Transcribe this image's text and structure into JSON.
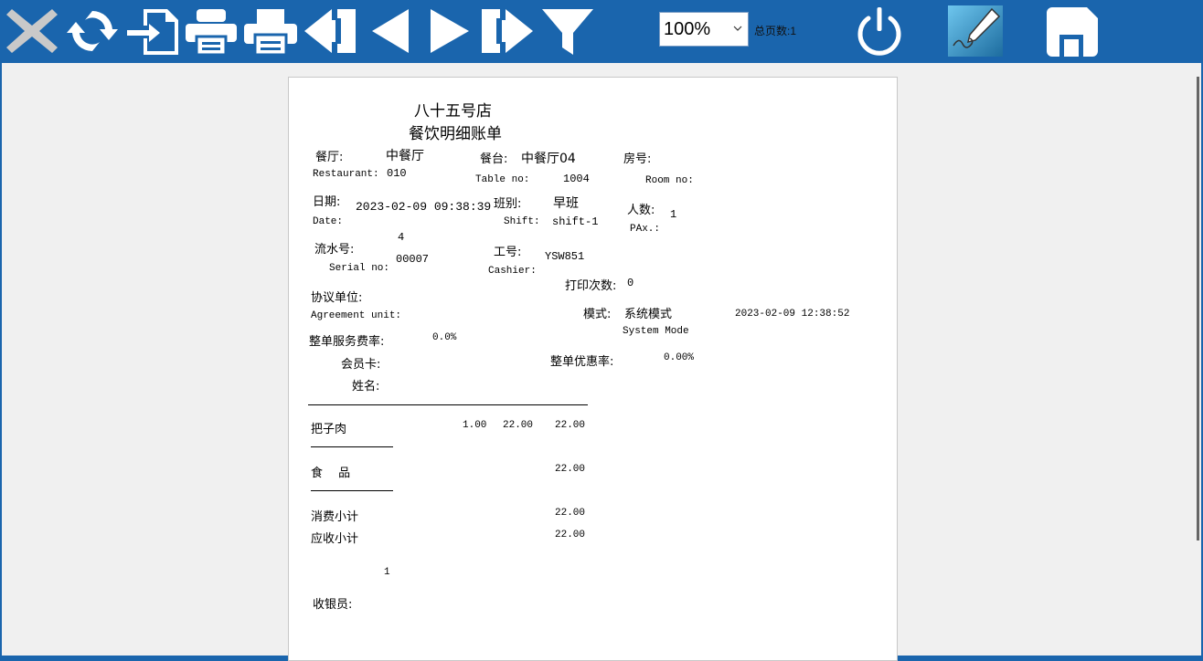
{
  "toolbar": {
    "buttons": [
      {
        "name": "close-icon",
        "label": "close"
      },
      {
        "name": "refresh-icon",
        "label": "refresh"
      },
      {
        "name": "export-icon",
        "label": "export"
      },
      {
        "name": "print-setup-icon",
        "label": "print setup"
      },
      {
        "name": "printer-icon",
        "label": "print"
      },
      {
        "name": "first-page-icon",
        "label": "first page"
      },
      {
        "name": "prev-page-icon",
        "label": "previous page"
      },
      {
        "name": "next-page-icon",
        "label": "next page"
      },
      {
        "name": "last-page-icon",
        "label": "last page"
      },
      {
        "name": "filter-icon",
        "label": "filter"
      },
      {
        "name": "power-icon",
        "label": "exit"
      },
      {
        "name": "signature-pen-icon",
        "label": "sign"
      },
      {
        "name": "save-icon",
        "label": "save"
      }
    ],
    "zoom": "100%",
    "page_count_label": "总页数:1",
    "colors": {
      "bar": "#1a65ad",
      "icon": "#ffffff",
      "close_icon": "#c9c9c9"
    }
  },
  "receipt": {
    "store_name": "八十五号店",
    "title": "餐饮明细账单",
    "restaurant_cn": "餐厅:",
    "restaurant_value": "中餐厅",
    "restaurant_en": "Restaurant:",
    "restaurant_code": "010",
    "table_cn": "餐台:",
    "table_value": "中餐厅04",
    "table_en": "Table no:",
    "table_no": "1004",
    "room_cn": "房号:",
    "room_en": "Room no:",
    "date_cn": "日期:",
    "date_value": "2023-02-09 09:38:39",
    "date_en": "Date:",
    "shift_cn": "班别:",
    "shift_value": "早班",
    "shift_en": "Shift:",
    "shift_code": "shift-1",
    "pax_cn": "人数:",
    "pax_en": "PAx.:",
    "pax_value": "1",
    "serial_cn": "流水号:",
    "serial_top": "4",
    "serial_en": "Serial no:",
    "serial_value": "00007",
    "cashier_cn": "工号:",
    "cashier_value": "YSW851",
    "cashier_en": "Cashier:",
    "print_count_cn": "打印次数:",
    "print_count_value": "0",
    "agreement_cn": "协议单位:",
    "agreement_en": "Agreement unit:",
    "mode_cn": "模式:",
    "mode_value": "系统模式",
    "mode_en": "System Mode",
    "mode_time": "2023-02-09 12:38:52",
    "service_rate_cn": "整单服务费率:",
    "service_rate_value": "0.0%",
    "member_card_cn": "会员卡:",
    "discount_rate_cn": "整单优惠率:",
    "discount_rate_value": "0.00%",
    "name_cn": "姓名:",
    "items": [
      {
        "name": "把子肉",
        "qty": "1.00",
        "price": "22.00",
        "amount": "22.00"
      }
    ],
    "category_label": "食　 品",
    "category_amount": "22.00",
    "consume_subtotal_label": "消费小计",
    "consume_subtotal": "22.00",
    "receivable_subtotal_label": "应收小计",
    "receivable_subtotal": "22.00",
    "footer_number": "1",
    "cashier_sign_label": "收银员:"
  }
}
